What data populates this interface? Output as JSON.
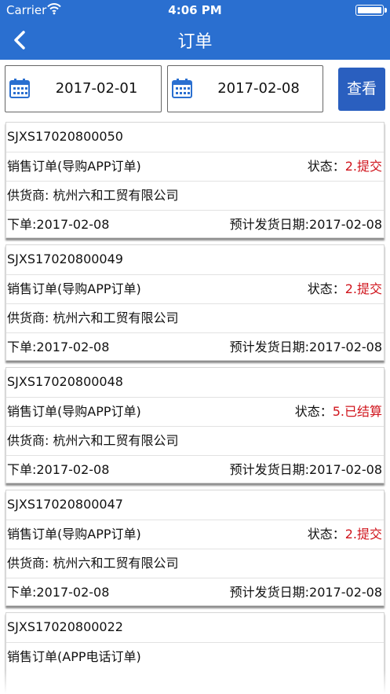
{
  "status_bar": {
    "carrier": "Carrier",
    "time": "4:06 PM"
  },
  "nav": {
    "title": "订单"
  },
  "filter": {
    "start_date": "2017-02-01",
    "end_date": "2017-02-08",
    "search_label": "查看"
  },
  "labels": {
    "status_prefix": "状态：",
    "supplier_prefix": "供货商: ",
    "order_prefix": "下单:",
    "ship_prefix": "预计发货日期:"
  },
  "orders": [
    {
      "id": "SJXS17020800050",
      "type": "销售订单(导购APP订单)",
      "status": "2.提交",
      "supplier": "杭州六和工贸有限公司",
      "order_date": "2017-02-08",
      "ship_date": "2017-02-08"
    },
    {
      "id": "SJXS17020800049",
      "type": "销售订单(导购APP订单)",
      "status": "2.提交",
      "supplier": "杭州六和工贸有限公司",
      "order_date": "2017-02-08",
      "ship_date": "2017-02-08"
    },
    {
      "id": "SJXS17020800048",
      "type": "销售订单(导购APP订单)",
      "status": "5.已结算",
      "supplier": "杭州六和工贸有限公司",
      "order_date": "2017-02-08",
      "ship_date": "2017-02-08"
    },
    {
      "id": "SJXS17020800047",
      "type": "销售订单(导购APP订单)",
      "status": "2.提交",
      "supplier": "杭州六和工贸有限公司",
      "order_date": "2017-02-08",
      "ship_date": "2017-02-08"
    },
    {
      "id": "SJXS17020800022",
      "type": "销售订单(APP电话订单)"
    }
  ],
  "colors": {
    "primary": "#2a6fd0",
    "button": "#2a5fbf",
    "status_red": "#d0141c"
  },
  "icons": [
    "wifi-icon",
    "battery-icon",
    "back-chevron-icon",
    "calendar-icon"
  ]
}
